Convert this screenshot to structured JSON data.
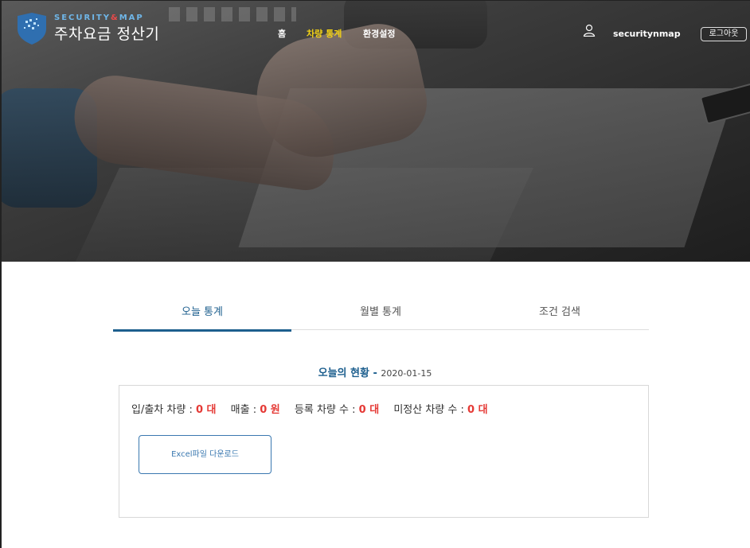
{
  "header": {
    "brand_en_a": "SECURITY",
    "brand_en_amp": "&",
    "brand_en_b": "MAP",
    "app_title": "주차요금 정산기",
    "nav": [
      {
        "label": "홈",
        "active": false
      },
      {
        "label": "차량 통계",
        "active": true
      },
      {
        "label": "환경설정",
        "active": false
      }
    ],
    "username": "securitynmap",
    "logout_label": "로그아웃"
  },
  "tabs": [
    {
      "label": "오늘 통계",
      "active": true
    },
    {
      "label": "월별 통계",
      "active": false
    },
    {
      "label": "조건 검색",
      "active": false
    }
  ],
  "status": {
    "heading": "오늘의 현황",
    "date_sep": " - ",
    "date": "2020-01-15"
  },
  "stats": [
    {
      "label": "입/출차 차량 : ",
      "value": "0 대"
    },
    {
      "label": "매출 : ",
      "value": "0 원"
    },
    {
      "label": "등록 차량 수 : ",
      "value": "0 대"
    },
    {
      "label": "미정산 차량 수 : ",
      "value": "0 대"
    }
  ],
  "excel_button_label": "Excel파일 다운로드",
  "colors": {
    "accent": "#1d5f8e",
    "nav_active": "#f3d215",
    "value_red": "#e53935"
  }
}
